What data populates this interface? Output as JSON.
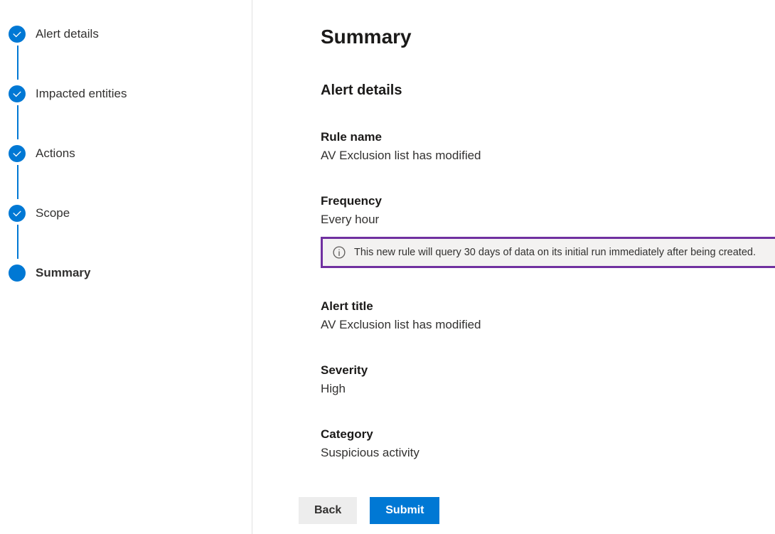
{
  "sidebar": {
    "steps": [
      {
        "label": "Alert details",
        "state": "completed"
      },
      {
        "label": "Impacted entities",
        "state": "completed"
      },
      {
        "label": "Actions",
        "state": "completed"
      },
      {
        "label": "Scope",
        "state": "completed"
      },
      {
        "label": "Summary",
        "state": "current"
      }
    ]
  },
  "main": {
    "title": "Summary",
    "section_title": "Alert details",
    "fields": {
      "rule_name": {
        "label": "Rule name",
        "value": "AV Exclusion list has modified"
      },
      "frequency": {
        "label": "Frequency",
        "value": "Every hour"
      },
      "alert_title": {
        "label": "Alert title",
        "value": "AV Exclusion list has modified"
      },
      "severity": {
        "label": "Severity",
        "value": "High"
      },
      "category": {
        "label": "Category",
        "value": "Suspicious activity"
      }
    },
    "info_banner": "This new rule will query 30 days of data on its initial run immediately after being created."
  },
  "footer": {
    "back_label": "Back",
    "submit_label": "Submit"
  }
}
